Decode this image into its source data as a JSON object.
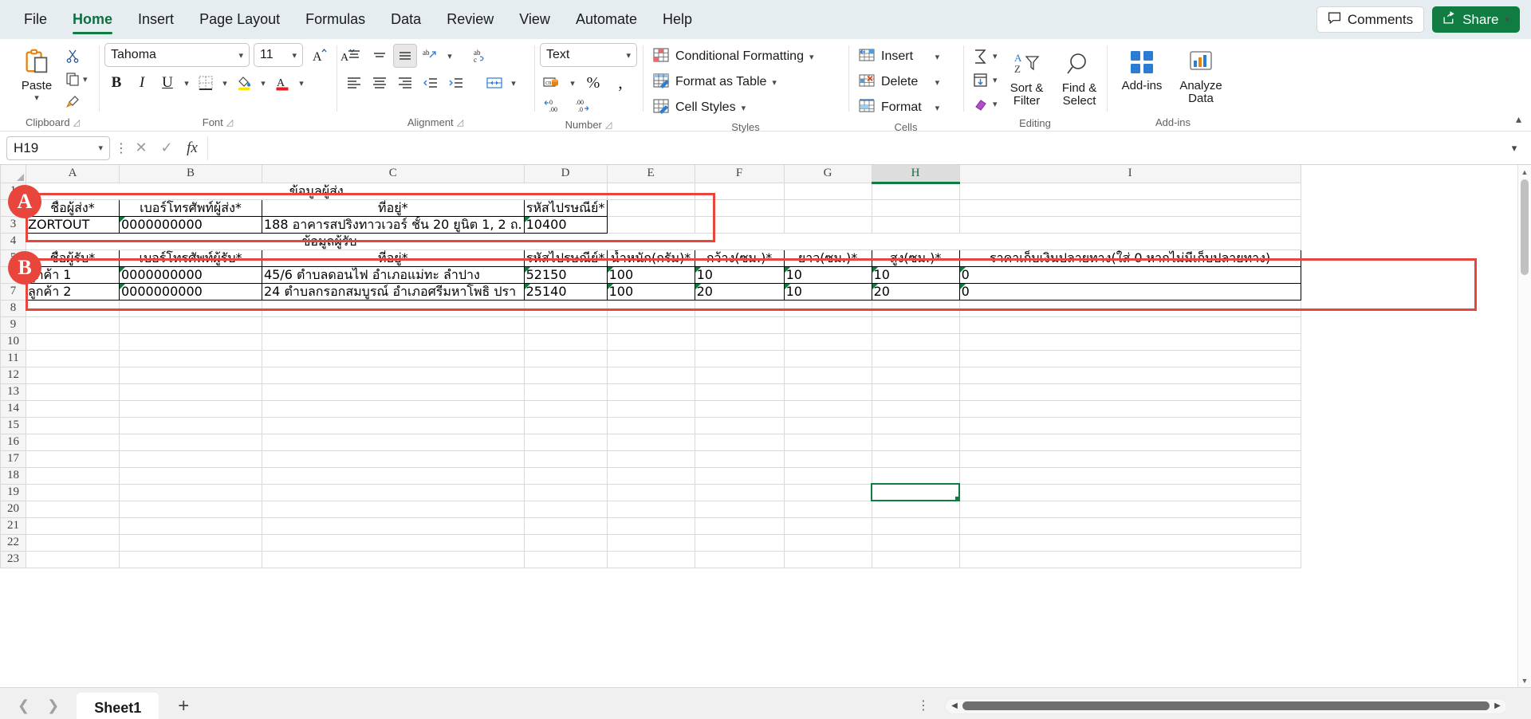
{
  "window": {
    "tabs": [
      "File",
      "Home",
      "Insert",
      "Page Layout",
      "Formulas",
      "Data",
      "Review",
      "View",
      "Automate",
      "Help"
    ],
    "active_tab": "Home",
    "comments_label": "Comments",
    "share_label": "Share"
  },
  "ribbon": {
    "groups": [
      {
        "name": "Clipboard",
        "label": "Clipboard"
      },
      {
        "name": "Font",
        "label": "Font"
      },
      {
        "name": "Alignment",
        "label": "Alignment"
      },
      {
        "name": "Number",
        "label": "Number"
      },
      {
        "name": "Styles",
        "label": "Styles"
      },
      {
        "name": "Cells",
        "label": "Cells"
      },
      {
        "name": "Editing",
        "label": "Editing"
      },
      {
        "name": "Add-ins",
        "label": "Add-ins"
      }
    ],
    "clipboard": {
      "paste_label": "Paste"
    },
    "font": {
      "family": "Tahoma",
      "size": "11"
    },
    "number": {
      "format": "Text"
    },
    "styles": {
      "conditional_formatting": "Conditional Formatting",
      "format_as_table": "Format as Table",
      "cell_styles": "Cell Styles"
    },
    "cells": {
      "insert": "Insert",
      "delete": "Delete",
      "format": "Format"
    },
    "editing": {
      "sort_filter": "Sort &\nFilter",
      "sort_filter_l1": "Sort &",
      "sort_filter_l2": "Filter",
      "find_select_l1": "Find &",
      "find_select_l2": "Select"
    },
    "addins": {
      "addins_label": "Add-ins",
      "analyze_l1": "Analyze",
      "analyze_l2": "Data"
    }
  },
  "formula_bar": {
    "name_box": "H19",
    "formula_value": "",
    "formula_placeholder": ""
  },
  "grid": {
    "columns": [
      "A",
      "B",
      "C",
      "D",
      "E",
      "F",
      "G",
      "H",
      "I"
    ],
    "active_column": "H",
    "active_cell": "H19",
    "row_numbers": [
      "1",
      "2",
      "3",
      "4",
      "5",
      "6",
      "7",
      "8",
      "9",
      "10",
      "11",
      "12",
      "13",
      "14",
      "15",
      "16",
      "17",
      "18",
      "19",
      "20",
      "21",
      "22",
      "23"
    ],
    "sender_section_title": "ข้อมูลผู้ส่ง",
    "receiver_section_title": "ข้อมูลผู้รับ",
    "sender_headers": [
      "ชื่อผู้ส่ง*",
      "เบอร์โทรศัพท์ผู้ส่ง*",
      "ที่อยู่*",
      "รหัสไปรษณีย์*"
    ],
    "sender_row": [
      "ZORTOUT",
      "0000000000",
      "188 อาคารสปริงทาวเวอร์ ชั้น 20 ยูนิต 1, 2 ถ.",
      "10400"
    ],
    "receiver_headers": [
      "ชื่อผู้รับ*",
      "เบอร์โทรศัพท์ผู้รับ*",
      "ที่อยู่*",
      "รหัสไปรษณีย์*",
      "น้ำหนัก(กรัม)*",
      "กว้าง(ซม.)*",
      "ยาว(ซม.)*",
      "สูง(ซม.)*",
      "ราคาเก็บเงินปลายทาง(ใส่ 0 หากไม่มีเก็บปลายทาง)"
    ],
    "receiver_rows": [
      [
        "ลูกค้า 1",
        "0000000000",
        "45/6 ตำบลดอนไฟ อำเภอแม่ทะ ลำปาง",
        "52150",
        "100",
        "10",
        "10",
        "10",
        "0"
      ],
      [
        "ลูกค้า 2",
        "0000000000",
        "24 ตำบลกรอกสมบูรณ์ อำเภอศรีมหาโพธิ ปรา",
        "25140",
        "100",
        "20",
        "10",
        "20",
        "0"
      ]
    ]
  },
  "annotations": [
    {
      "badge": "A",
      "target": "sender-table"
    },
    {
      "badge": "B",
      "target": "receiver-table"
    }
  ],
  "sheetbar": {
    "sheet_name": "Sheet1",
    "add_sheet_label": "+"
  },
  "colors": {
    "accent_green": "#107c41",
    "annotation_red": "#e8453c",
    "ribbon_bg": "#e6edf0"
  }
}
